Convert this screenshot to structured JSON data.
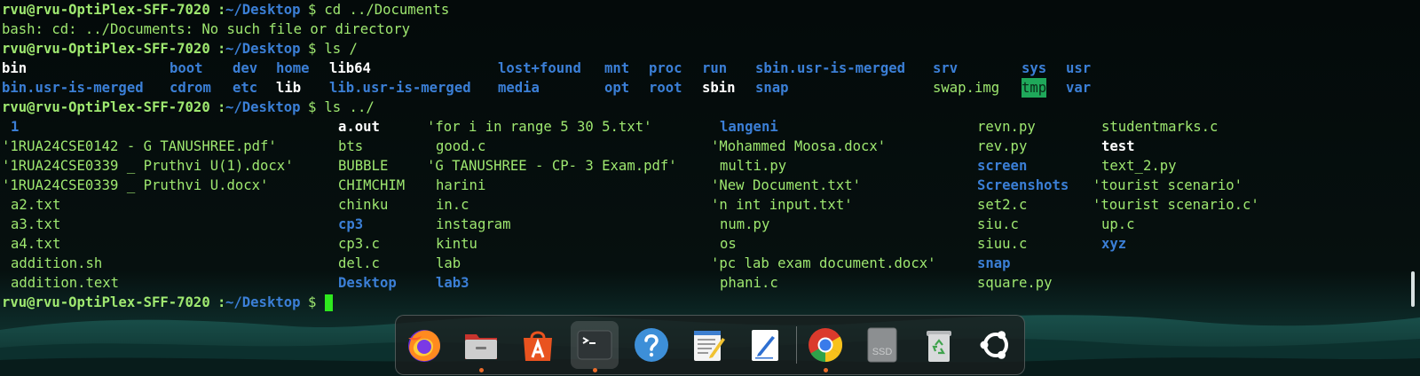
{
  "terminal": {
    "prompt": {
      "user_host": "rvu@rvu-OptiPlex-SFF-7020",
      "colon": ":",
      "path": "~/Desktop",
      "dollar": "$"
    },
    "lines": [
      {
        "type": "prompt",
        "command": " cd ../Documents"
      },
      {
        "type": "output",
        "text": "bash: cd: ../Documents: No such file or directory"
      },
      {
        "type": "prompt",
        "command": " ls /"
      },
      {
        "type": "prompt",
        "command": " ls ../"
      },
      {
        "type": "prompt",
        "command": " "
      }
    ],
    "ls_root": {
      "row1": [
        "bin",
        "boot",
        "dev",
        "home",
        "lib64",
        "lost+found",
        "mnt",
        "proc",
        "run",
        "sbin.usr-is-merged",
        "srv",
        "sys",
        "usr"
      ],
      "row2": [
        "bin.usr-is-merged",
        "cdrom",
        "etc",
        "lib",
        "lib.usr-is-merged",
        "media",
        "opt",
        "root",
        "sbin",
        "snap",
        "swap.img",
        "tmp",
        "var"
      ]
    },
    "ls_parent": {
      "col1": [
        "1",
        "'1RUA24CSE0142 - G TANUSHREE.pdf'",
        "'1RUA24CSE0339 _ Pruthvi U(1).docx'",
        "'1RUA24CSE0339 _ Pruthvi U.docx'",
        "a2.txt",
        "a3.txt",
        "a4.txt",
        "addition.sh",
        "addition.text"
      ],
      "col2": [
        "a.out",
        "bts",
        "BUBBLE",
        "CHIMCHIM",
        "chinku",
        "cp3",
        "cp3.c",
        "del.c",
        "Desktop"
      ],
      "col3": [
        "'for i in range 5 30 5.txt'",
        "good.c",
        "'G TANUSHREE - CP- 3 Exam.pdf'",
        "harini",
        "in.c",
        "instagram",
        "kintu",
        "lab",
        "lab3"
      ],
      "col4": [
        "langeni",
        "'Mohammed Moosa.docx'",
        "multi.py",
        "'New Document.txt'",
        "'n int input.txt'",
        "num.py",
        "os",
        "'pc lab exam document.docx'",
        "phani.c"
      ],
      "col5": [
        "revn.py",
        "rev.py",
        "screen",
        "Screenshots",
        "set2.c",
        "siu.c",
        "siuu.c",
        "snap",
        "square.py"
      ],
      "col6": [
        "studentmarks.c",
        "test",
        "text_2.py",
        "'tourist scenario'",
        "'tourist scenario.c'",
        "up.c",
        "xyz"
      ]
    }
  },
  "dock": {
    "items": [
      {
        "name": "firefox",
        "icon": "firefox-icon",
        "running": false
      },
      {
        "name": "files",
        "icon": "files-icon",
        "running": true
      },
      {
        "name": "app-center",
        "icon": "app-center-icon",
        "running": false
      },
      {
        "name": "terminal",
        "icon": "terminal-icon",
        "running": true,
        "active": true
      },
      {
        "name": "help",
        "icon": "help-icon",
        "running": false
      },
      {
        "name": "text-editor",
        "icon": "text-editor-icon",
        "running": false
      },
      {
        "name": "notes",
        "icon": "notes-icon",
        "running": false
      },
      {
        "name": "chrome",
        "icon": "chrome-icon",
        "running": true
      },
      {
        "name": "ssd",
        "icon": "ssd-drive-icon",
        "label": "SSD",
        "running": false
      },
      {
        "name": "trash",
        "icon": "trash-icon",
        "running": false
      },
      {
        "name": "show-apps",
        "icon": "ubuntu-apps-icon",
        "running": false
      }
    ]
  },
  "colors": {
    "prompt_green": "#9fe870",
    "dir_blue": "#3b7fd6",
    "cursor_green": "#2ee81e",
    "tmp_highlight": "#1fa85a",
    "background": "#050c0c"
  }
}
